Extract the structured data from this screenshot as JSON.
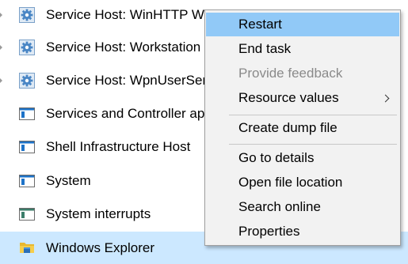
{
  "processes": [
    {
      "name": "Service Host: WinHTTP Web Proxy Auto-Discovery Service",
      "icon": "gear-icon",
      "expandable": true
    },
    {
      "name": "Service Host: Workstation",
      "icon": "gear-icon",
      "expandable": true
    },
    {
      "name": "Service Host: WpnUserService",
      "icon": "gear-icon",
      "expandable": true
    },
    {
      "name": "Services and Controller app",
      "icon": "app-window-icon",
      "expandable": false
    },
    {
      "name": "Shell Infrastructure Host",
      "icon": "app-window-icon",
      "expandable": false
    },
    {
      "name": "System",
      "icon": "app-window-icon",
      "expandable": false
    },
    {
      "name": "System interrupts",
      "icon": "system-window-icon",
      "expandable": false
    },
    {
      "name": "Windows Explorer",
      "icon": "folder-icon",
      "expandable": false,
      "selected": true
    }
  ],
  "context_menu": {
    "items": [
      {
        "label": "Restart",
        "state": "highlighted"
      },
      {
        "label": "End task",
        "state": "enabled"
      },
      {
        "label": "Provide feedback",
        "state": "disabled"
      },
      {
        "label": "Resource values",
        "state": "enabled",
        "submenu": true
      },
      {
        "label": "Create dump file",
        "state": "enabled"
      },
      {
        "label": "Go to details",
        "state": "enabled"
      },
      {
        "label": "Open file location",
        "state": "enabled"
      },
      {
        "label": "Search online",
        "state": "enabled"
      },
      {
        "label": "Properties",
        "state": "enabled"
      }
    ]
  },
  "colors": {
    "selected_row": "#cce8ff",
    "menu_highlight": "#91c9f7",
    "menu_background": "#f2f2f2",
    "disabled_text": "#8a8a8a"
  }
}
